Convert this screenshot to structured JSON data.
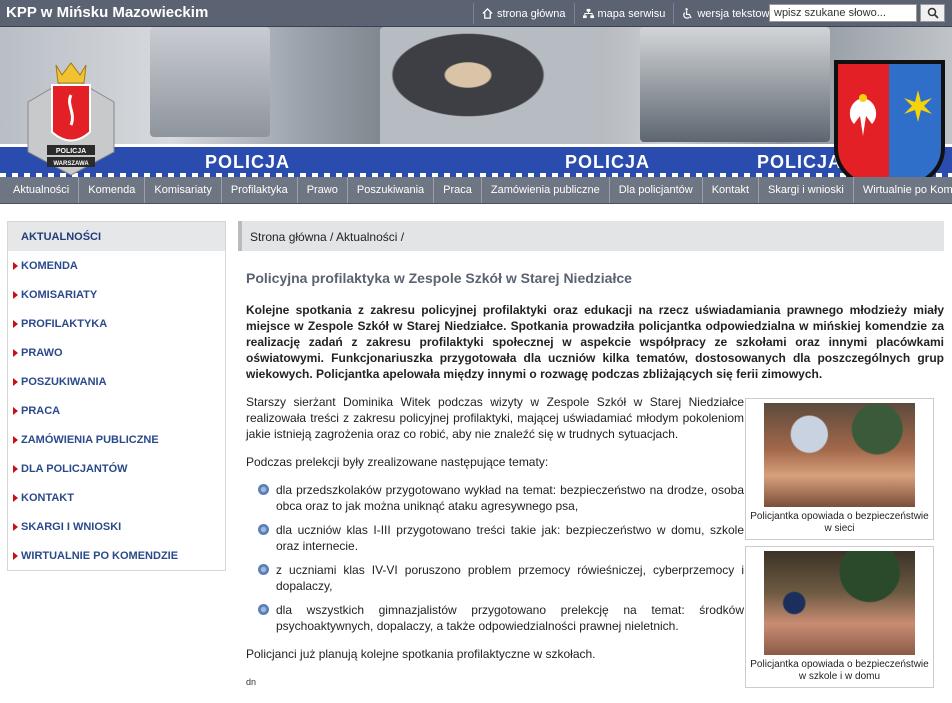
{
  "header": {
    "site_title": "KPP w Mińsku Mazowieckim",
    "links": [
      {
        "label": "strona główna",
        "icon": "home-icon"
      },
      {
        "label": "mapa serwisu",
        "icon": "sitemap-icon"
      },
      {
        "label": "wersja tekstowa",
        "icon": "accessibility-icon"
      }
    ],
    "search_placeholder": "wpisz szukane słowo..."
  },
  "banner": {
    "police_text": "POLICJA",
    "logo_left_text": "POLICJA",
    "logo_left_subtext": "WARSZAWA",
    "colors": {
      "strip": "#2a4cae",
      "shield_red": "#e32026",
      "shield_blue": "#2f6fc9",
      "star_yellow": "#f5d20a"
    }
  },
  "nav": [
    "Aktualności",
    "Komenda",
    "Komisariaty",
    "Profilaktyka",
    "Prawo",
    "Poszukiwania",
    "Praca",
    "Zamówienia publiczne",
    "Dla policjantów",
    "Kontakt",
    "Skargi i wnioski",
    "Wirtualnie po Komendzie"
  ],
  "sidebar": {
    "active": "AKTUALNOŚCI",
    "items": [
      "KOMENDA",
      "KOMISARIATY",
      "PROFILAKTYKA",
      "PRAWO",
      "POSZUKIWANIA",
      "PRACA",
      "ZAMÓWIENIA PUBLICZNE",
      "DLA POLICJANTÓW",
      "KONTAKT",
      "SKARGI I WNIOSKI",
      "WIRTUALNIE PO KOMENDZIE"
    ]
  },
  "breadcrumb": "Strona główna / Aktualności /",
  "article": {
    "title": "Policyjna profilaktyka w Zespole Szkół w Starej Niedziałce",
    "lead": "Kolejne spotkania z zakresu policyjnej profilaktyki oraz edukacji na rzecz uświadamiania prawnego młodzieży miały miejsce w Zespole Szkół w Starej Niedziałce. Spotkania prowadziła policjantka odpowiedzialna w mińskiej komendzie za realizację zadań z zakresu profilaktyki społecznej w aspekcie współpracy ze szkołami oraz innymi placówkami oświatowymi. Funkcjonariuszka przygotowała dla uczniów kilka tematów, dostosowanych dla poszczególnych grup wiekowych. Policjantka apelowała między innymi o rozwagę podczas zbliżających się ferii zimowych.",
    "p1": "Starszy sierżant Dominika Witek podczas wizyty w Zespole Szkół w Starej Niedziałce realizowała treści z zakresu policyjnej profilaktyki, mającej uświadamiać młodym pokoleniom jakie istnieją zagrożenia oraz co robić, aby nie znaleźć się w trudnych sytuacjach.",
    "p2": "Podczas prelekcji były zrealizowane następujące tematy:",
    "list": [
      "dla przedszkolaków przygotowano wykład na temat: bezpieczeństwo na drodze, osoba obca oraz to jak można uniknąć ataku agresywnego psa,",
      "dla uczniów klas I-III przygotowano treści takie jak: bezpieczeństwo w domu, szkole oraz internecie.",
      "z uczniami klas IV-VI poruszono problem przemocy rówieśniczej, cyberprzemocy i dopalaczy,",
      "dla wszystkich gimnazjalistów przygotowano prelekcję na temat: środków psychoaktywnych, dopalaczy, a także odpowiedzialności prawnej nieletnich."
    ],
    "p3": "Policjanci już planują kolejne spotkania profilaktyczne w szkołach.",
    "sign": "dn",
    "figures": [
      {
        "caption": "Policjantka opowiada o bezpieczeństwie w sieci"
      },
      {
        "caption": "Policjantka opowiada o bezpieczeństwie w szkole i w domu"
      }
    ]
  }
}
